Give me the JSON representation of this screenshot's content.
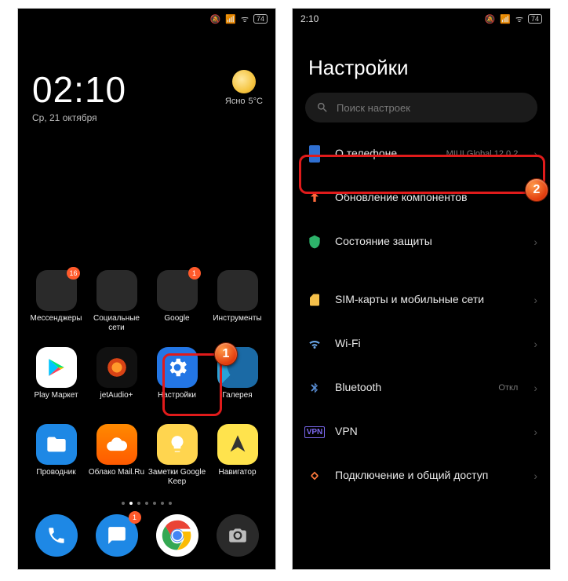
{
  "status": {
    "time": "2:10",
    "battery": "74",
    "signal_icon": "signal-icon",
    "wifi_icon": "wifi-icon",
    "mute_icon": "mute-icon"
  },
  "home": {
    "clock_time": "02:10",
    "clock_date": "Ср, 21 октября",
    "weather_cond": "Ясно",
    "weather_temp": "5°C",
    "apps": [
      {
        "label": "Мессенджеры",
        "type": "folder",
        "badge": "16"
      },
      {
        "label": "Социальные сети",
        "type": "folder"
      },
      {
        "label": "Google",
        "type": "folder",
        "badge": "1"
      },
      {
        "label": "Инструменты",
        "type": "folder"
      },
      {
        "label": "Play Маркет",
        "type": "app",
        "cls": "ic-play"
      },
      {
        "label": "jetAudio+",
        "type": "app",
        "cls": "ic-jet"
      },
      {
        "label": "Настройки",
        "type": "app",
        "cls": "ic-settings"
      },
      {
        "label": "Галерея",
        "type": "app",
        "cls": "ic-gallery"
      },
      {
        "label": "Проводник",
        "type": "app",
        "cls": "ic-files"
      },
      {
        "label": "Облако Mail.Ru",
        "type": "app",
        "cls": "ic-cloud"
      },
      {
        "label": "Заметки Google Keep",
        "type": "app",
        "cls": "ic-keep"
      },
      {
        "label": "Навигатор",
        "type": "app",
        "cls": "ic-nav"
      }
    ],
    "dock": [
      {
        "name": "phone-app",
        "cls": "ic-phone"
      },
      {
        "name": "messages-app",
        "cls": "ic-msg",
        "badge": "1"
      },
      {
        "name": "chrome-app",
        "cls": "ic-chrome"
      },
      {
        "name": "camera-app",
        "cls": "ic-camera"
      }
    ]
  },
  "settings": {
    "title": "Настройки",
    "search_placeholder": "Поиск настроек",
    "items": [
      {
        "icon": "phone-info-icon",
        "label": "О телефоне",
        "sub": "MIUI Global 12.0.2",
        "color": "#2f6fd1"
      },
      {
        "icon": "update-icon",
        "label": "Обновление компонентов",
        "color": "#ff6a3d"
      },
      {
        "icon": "shield-icon",
        "label": "Состояние защиты",
        "color": "#2db36a"
      }
    ],
    "items2": [
      {
        "icon": "sim-icon",
        "label": "SIM-карты и мобильные сети",
        "color": "#f5c04a"
      },
      {
        "icon": "wifi-icon",
        "label": "Wi-Fi",
        "color": "#6aa7e8"
      },
      {
        "icon": "bluetooth-icon",
        "label": "Bluetooth",
        "sub": "Откл",
        "color": "#5a8fd6"
      },
      {
        "icon": "vpn-icon",
        "label": "VPN",
        "color": "#7b68ee"
      },
      {
        "icon": "share-icon",
        "label": "Подключение и общий доступ",
        "color": "#ff7a3d"
      }
    ]
  },
  "markers": {
    "m1": "1",
    "m2": "2"
  }
}
